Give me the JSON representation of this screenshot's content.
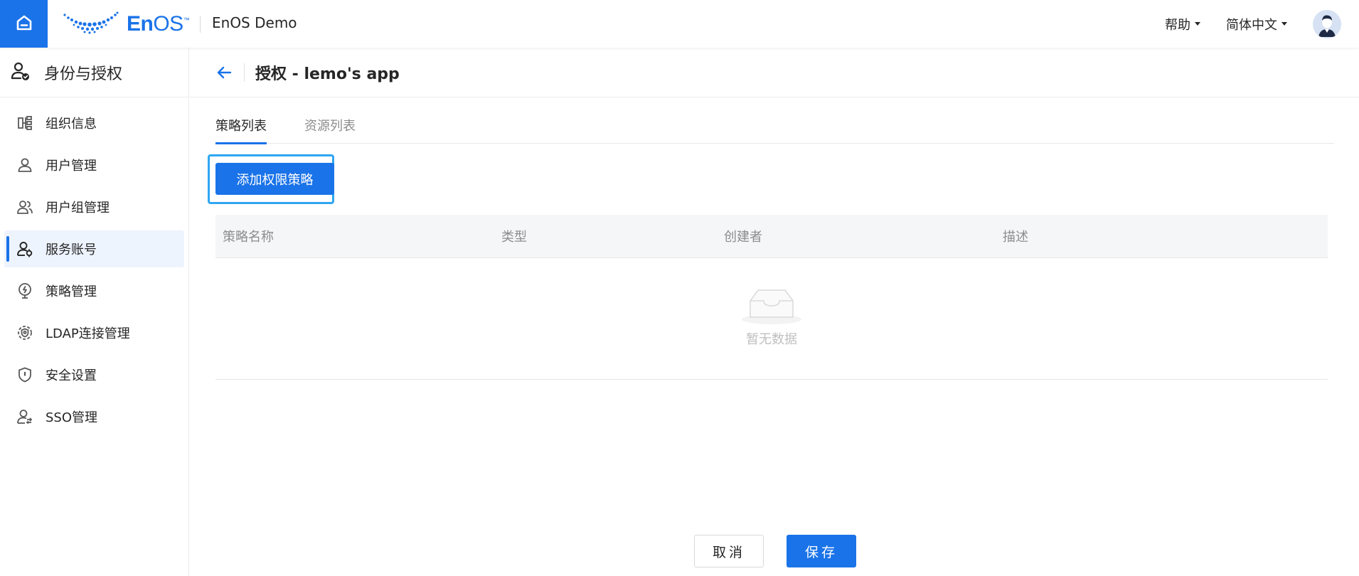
{
  "header": {
    "home_icon": "home-icon",
    "logo_text_bold": "En",
    "logo_text_regular": "OS",
    "logo_tm": "™",
    "app_name": "EnOS Demo",
    "help_label": "帮助",
    "language_label": "简体中文",
    "avatar_icon": "user-avatar-icon"
  },
  "sidebar": {
    "title": "身份与授权",
    "title_icon": "identity-icon",
    "items": [
      {
        "label": "组织信息",
        "icon": "org-icon",
        "active": false
      },
      {
        "label": "用户管理",
        "icon": "user-icon",
        "active": false
      },
      {
        "label": "用户组管理",
        "icon": "user-group-icon",
        "active": false
      },
      {
        "label": "服务账号",
        "icon": "service-account-icon",
        "active": true
      },
      {
        "label": "策略管理",
        "icon": "policy-icon",
        "active": false
      },
      {
        "label": "LDAP连接管理",
        "icon": "ldap-icon",
        "active": false
      },
      {
        "label": "安全设置",
        "icon": "shield-icon",
        "active": false
      },
      {
        "label": "SSO管理",
        "icon": "sso-icon",
        "active": false
      }
    ]
  },
  "main": {
    "title": "授权 - lemo's app",
    "tabs": [
      {
        "label": "策略列表",
        "active": true
      },
      {
        "label": "资源列表",
        "active": false
      }
    ],
    "add_button": "添加权限策略",
    "table": {
      "columns": [
        "策略名称",
        "类型",
        "创建者",
        "描述"
      ],
      "rows": [],
      "empty_text": "暂无数据"
    },
    "cancel_label": "取消",
    "save_label": "保存"
  },
  "colors": {
    "primary": "#1a73e8",
    "focus_ring": "#2ea6f2",
    "active_bg": "#eef4fe"
  }
}
